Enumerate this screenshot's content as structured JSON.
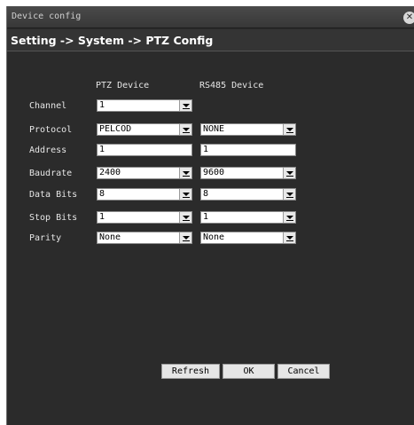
{
  "window": {
    "title": "Device config",
    "close_icon": "close-icon"
  },
  "breadcrumb": "Setting -> System -> PTZ Config",
  "columns": {
    "ptz": "PTZ Device",
    "rs485": "RS485 Device"
  },
  "rows": {
    "channel": {
      "label": "Channel",
      "ptz": "1"
    },
    "protocol": {
      "label": "Protocol",
      "ptz": "PELCOD",
      "rs485": "NONE"
    },
    "address": {
      "label": "Address",
      "ptz": "1",
      "rs485": "1"
    },
    "baudrate": {
      "label": "Baudrate",
      "ptz": "2400",
      "rs485": "9600"
    },
    "data_bits": {
      "label": "Data Bits",
      "ptz": "8",
      "rs485": "8"
    },
    "stop_bits": {
      "label": "Stop Bits",
      "ptz": "1",
      "rs485": "1"
    },
    "parity": {
      "label": "Parity",
      "ptz": "None",
      "rs485": "None"
    }
  },
  "buttons": {
    "refresh": "Refresh",
    "ok": "OK",
    "cancel": "Cancel"
  }
}
